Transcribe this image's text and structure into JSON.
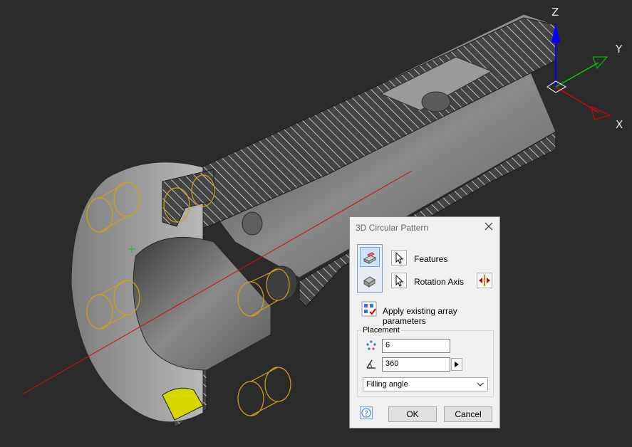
{
  "viewport": {
    "axes": {
      "z_label": "Z",
      "y_label": "Y",
      "x_label": "X"
    }
  },
  "dialog": {
    "title": "3D Circular Pattern",
    "features_label": "Features",
    "rotation_axis_label": "Rotation Axis",
    "apply_existing_label": "Apply existing array parameters",
    "placement": {
      "group_label": "Placement",
      "count_value": "6",
      "angle_value": "360",
      "mode_selected": "Filling angle"
    },
    "ok_label": "OK",
    "cancel_label": "Cancel"
  },
  "colors": {
    "background": "#2b2b2b",
    "selection": "#d4a017",
    "axis_z": "#0000ff",
    "axis_y": "#00cc00",
    "axis_x": "#e00000",
    "highlight_face": "#d6d600"
  }
}
